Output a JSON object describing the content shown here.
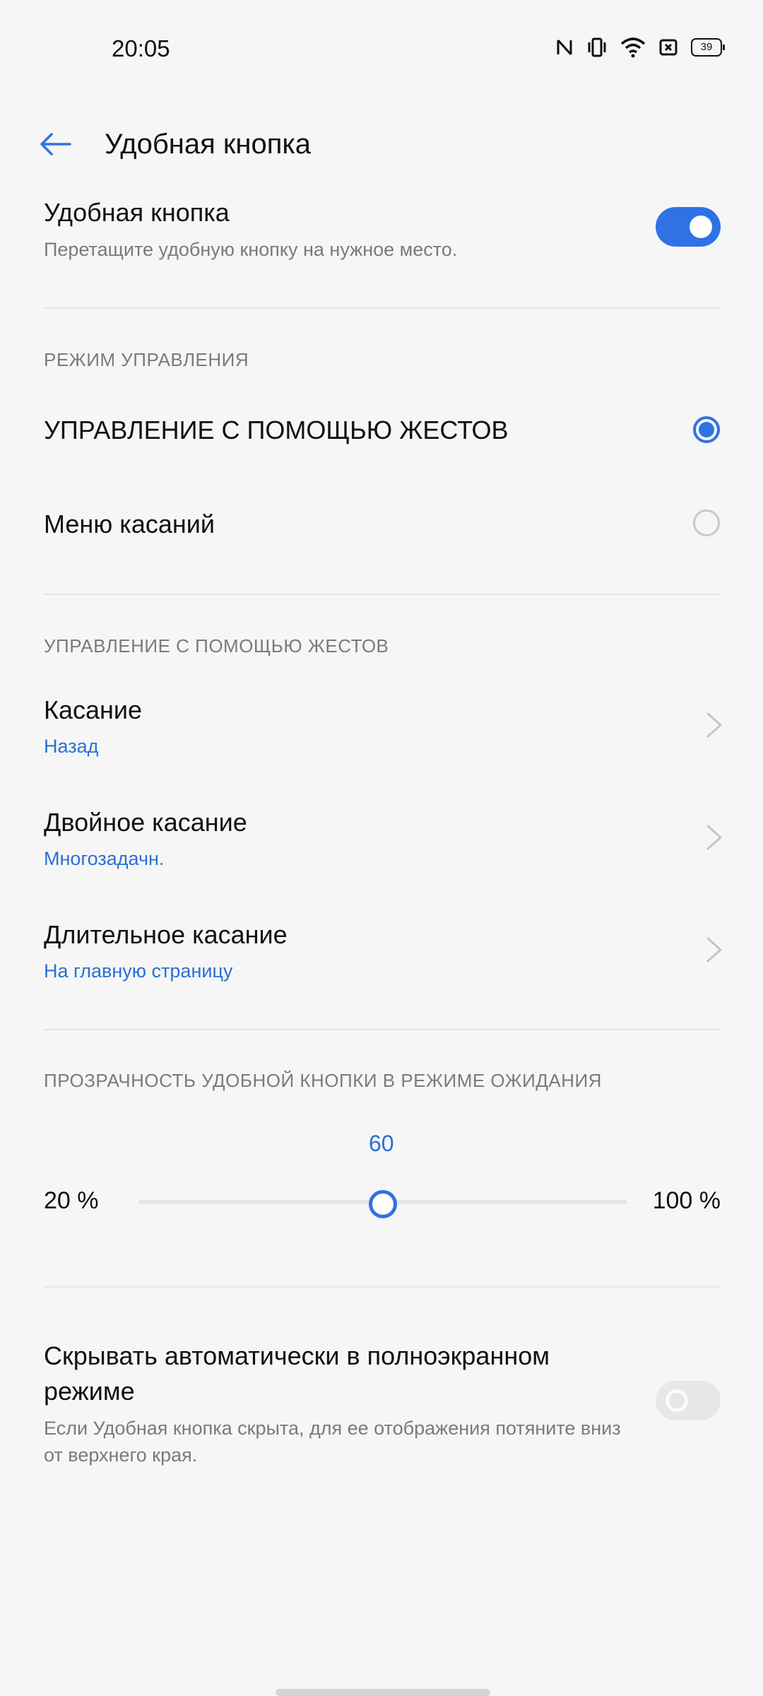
{
  "status_bar": {
    "time": "20:05",
    "battery": "39",
    "icons": [
      "nfc-icon",
      "vibrate-icon",
      "wifi-icon",
      "sim-off-icon",
      "battery-icon"
    ]
  },
  "header": {
    "title": "Удобная кнопка"
  },
  "main_toggle": {
    "title": "Удобная кнопка",
    "subtitle": "Перетащите удобную кнопку на нужное место.",
    "enabled": true
  },
  "control_mode": {
    "section_label": "РЕЖИМ УПРАВЛЕНИЯ",
    "options": [
      {
        "label": "УПРАВЛЕНИЕ С ПОМОЩЬЮ ЖЕСТОВ",
        "selected": true
      },
      {
        "label": "Меню касаний",
        "selected": false
      }
    ]
  },
  "gestures": {
    "section_label": "УПРАВЛЕНИЕ С ПОМОЩЬЮ ЖЕСТОВ",
    "items": [
      {
        "title": "Касание",
        "value": "Назад"
      },
      {
        "title": "Двойное касание",
        "value": "Многозадачн."
      },
      {
        "title": "Длительное касание",
        "value": "На главную страницу"
      }
    ]
  },
  "transparency": {
    "section_label": "ПРОЗРАЧНОСТЬ УДОБНОЙ КНОПКИ В РЕЖИМЕ ОЖИДАНИЯ",
    "value": "60",
    "min_label": "20 %",
    "max_label": "100 %",
    "min": 20,
    "max": 100,
    "current": 60
  },
  "auto_hide": {
    "title": "Скрывать автоматически в полноэкранном режиме",
    "subtitle": "Если Удобная кнопка скрыта, для ее отображения потяните вниз от верхнего края.",
    "enabled": false
  },
  "colors": {
    "accent": "#2f72e6",
    "link": "#2a6fd6",
    "background": "#f6f6f7"
  }
}
